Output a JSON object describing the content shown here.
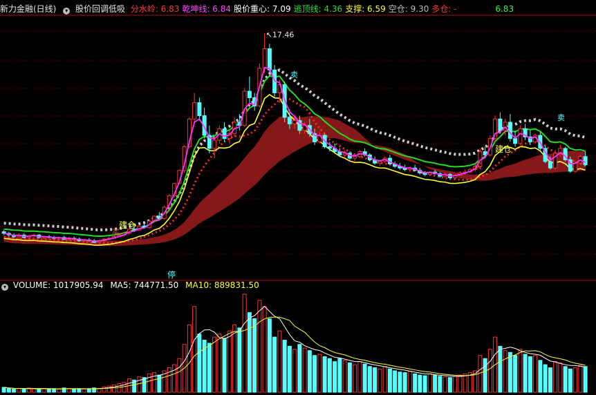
{
  "header": {
    "title": "新力金融(日线)",
    "indicator_name": "股价回调低吸",
    "fields": [
      {
        "label": "分水岭:",
        "value": "6.83",
        "color": "#ff3b3b"
      },
      {
        "label": "乾坤线:",
        "value": "6.84",
        "color": "#ff44ff"
      },
      {
        "label": "股价重心:",
        "value": "7.09",
        "color": "#ffffff"
      },
      {
        "label": "逃顶线:",
        "value": "4.36",
        "color": "#33dd33"
      },
      {
        "label": "支撑:",
        "value": "6.59",
        "color": "#ffff33"
      },
      {
        "label": "空仓:",
        "value": "9.30",
        "color": "#bbbbbb"
      },
      {
        "label": "多仓:",
        "value": "-",
        "color": "#ff3333"
      },
      {
        "label": "",
        "value": "6.83",
        "color": "#33ff33"
      }
    ]
  },
  "volume_header": {
    "volume_label": "VOLUME:",
    "volume_value": "1017905.94",
    "ma5_label": "MA5:",
    "ma5_value": "744771.50",
    "ma10_label": "MA10:",
    "ma10_value": "889831.50"
  },
  "annotations": {
    "high_price": "17.46",
    "limit_up": "停",
    "build_position": "建仓",
    "sell": "卖",
    "buy": "买"
  },
  "colors": {
    "background": "#000000",
    "up_candle": "#ff3333",
    "down_candle": "#54ffff",
    "grid": "#8b0000",
    "line_green": "#22dd22",
    "line_magenta": "#ff33ff",
    "line_yellow": "#ffff33",
    "band_red": "#b22222",
    "band_green": "#1f6b3a"
  },
  "chart_data": {
    "type": "candlestick",
    "title": "新力金融(日线)",
    "ohlc": [
      [
        5.3,
        5.4,
        5.1,
        5.2
      ],
      [
        5.2,
        5.3,
        5.0,
        5.1
      ],
      [
        5.1,
        5.2,
        4.9,
        5.0
      ],
      [
        5.0,
        5.2,
        4.9,
        5.1
      ],
      [
        5.1,
        5.2,
        4.9,
        4.95
      ],
      [
        4.95,
        5.1,
        4.85,
        5.05
      ],
      [
        5.05,
        5.2,
        4.95,
        5.1
      ],
      [
        5.1,
        5.15,
        4.9,
        4.95
      ],
      [
        4.95,
        5.05,
        4.85,
        5.0
      ],
      [
        5.0,
        5.1,
        4.9,
        4.95
      ],
      [
        4.95,
        5.05,
        4.85,
        4.9
      ],
      [
        4.9,
        5.0,
        4.8,
        4.95
      ],
      [
        4.95,
        5.05,
        4.8,
        4.85
      ],
      [
        4.85,
        5.0,
        4.75,
        4.9
      ],
      [
        4.9,
        5.0,
        4.8,
        4.85
      ],
      [
        4.85,
        4.95,
        4.7,
        4.75
      ],
      [
        4.75,
        4.85,
        4.65,
        4.8
      ],
      [
        4.8,
        4.9,
        4.7,
        4.75
      ],
      [
        4.75,
        4.85,
        4.6,
        4.65
      ],
      [
        4.65,
        4.8,
        4.6,
        4.75
      ],
      [
        4.75,
        4.9,
        4.7,
        4.85
      ],
      [
        4.85,
        5.0,
        4.8,
        4.9
      ],
      [
        4.9,
        5.1,
        4.85,
        5.0
      ],
      [
        5.0,
        5.2,
        4.95,
        5.1
      ],
      [
        5.1,
        5.3,
        5.0,
        5.2
      ],
      [
        5.2,
        5.5,
        5.1,
        5.45
      ],
      [
        5.45,
        5.6,
        5.3,
        5.4
      ],
      [
        5.4,
        5.7,
        5.35,
        5.65
      ],
      [
        5.65,
        5.8,
        5.5,
        5.55
      ],
      [
        5.55,
        6.0,
        5.5,
        5.95
      ],
      [
        5.95,
        6.3,
        5.9,
        6.25
      ],
      [
        6.25,
        6.5,
        6.0,
        6.1
      ],
      [
        6.1,
        6.9,
        6.05,
        6.8
      ],
      [
        6.8,
        7.6,
        6.7,
        7.5
      ],
      [
        7.5,
        8.3,
        7.4,
        8.25
      ],
      [
        8.25,
        9.1,
        8.2,
        9.05
      ],
      [
        9.05,
        10.6,
        8.9,
        10.5
      ],
      [
        10.5,
        12.3,
        10.4,
        12.2
      ],
      [
        12.2,
        13.8,
        11.9,
        13.2
      ],
      [
        13.2,
        13.5,
        12.1,
        12.4
      ],
      [
        12.4,
        12.9,
        11.0,
        11.2
      ],
      [
        11.2,
        11.8,
        10.1,
        10.4
      ],
      [
        10.4,
        11.1,
        9.8,
        10.9
      ],
      [
        10.9,
        11.8,
        10.7,
        11.6
      ],
      [
        11.6,
        12.0,
        10.8,
        11.0
      ],
      [
        11.0,
        11.5,
        10.7,
        11.3
      ],
      [
        11.3,
        12.3,
        11.1,
        12.0
      ],
      [
        12.0,
        12.5,
        11.5,
        11.8
      ],
      [
        11.8,
        14.1,
        11.7,
        13.9
      ],
      [
        13.9,
        14.8,
        13.2,
        13.5
      ],
      [
        13.5,
        13.8,
        12.7,
        13.0
      ],
      [
        13.0,
        15.6,
        12.9,
        15.3
      ],
      [
        15.3,
        17.46,
        15.0,
        16.5
      ],
      [
        16.5,
        16.8,
        14.8,
        15.2
      ],
      [
        15.2,
        15.5,
        13.5,
        13.8
      ],
      [
        13.8,
        14.6,
        13.2,
        14.3
      ],
      [
        14.3,
        14.5,
        12.0,
        12.3
      ],
      [
        12.3,
        12.8,
        11.6,
        11.9
      ],
      [
        11.9,
        12.4,
        11.6,
        12.1
      ],
      [
        12.1,
        12.4,
        11.3,
        11.5
      ],
      [
        11.5,
        12.0,
        11.3,
        11.8
      ],
      [
        11.8,
        12.2,
        11.1,
        11.3
      ],
      [
        11.3,
        11.6,
        10.6,
        10.8
      ],
      [
        10.8,
        11.4,
        10.7,
        11.2
      ],
      [
        11.2,
        11.3,
        10.4,
        10.5
      ],
      [
        10.5,
        10.8,
        10.2,
        10.4
      ],
      [
        10.4,
        10.7,
        10.1,
        10.2
      ],
      [
        10.2,
        10.4,
        9.9,
        10.0
      ],
      [
        10.0,
        10.3,
        9.8,
        10.1
      ],
      [
        10.1,
        10.2,
        9.7,
        9.8
      ],
      [
        9.8,
        10.1,
        9.6,
        9.9
      ],
      [
        9.9,
        10.3,
        9.8,
        10.2
      ],
      [
        10.2,
        10.4,
        9.9,
        10.0
      ],
      [
        10.0,
        10.1,
        9.6,
        9.7
      ],
      [
        9.7,
        9.9,
        9.4,
        9.5
      ],
      [
        9.5,
        9.7,
        9.3,
        9.6
      ],
      [
        9.6,
        9.9,
        9.5,
        9.8
      ],
      [
        9.8,
        10.0,
        9.4,
        9.45
      ],
      [
        9.45,
        9.6,
        9.2,
        9.3
      ],
      [
        9.3,
        9.5,
        9.1,
        9.2
      ],
      [
        9.2,
        9.4,
        9.0,
        9.1
      ],
      [
        9.1,
        9.3,
        8.95,
        9.2
      ],
      [
        9.2,
        9.4,
        9.0,
        9.05
      ],
      [
        9.05,
        9.2,
        8.8,
        8.9
      ],
      [
        8.9,
        9.0,
        8.7,
        8.8
      ],
      [
        8.8,
        9.0,
        8.7,
        8.95
      ],
      [
        8.95,
        9.1,
        8.8,
        8.85
      ],
      [
        8.85,
        8.95,
        8.6,
        8.7
      ],
      [
        8.7,
        8.9,
        8.6,
        8.8
      ],
      [
        8.8,
        8.9,
        8.5,
        8.6
      ],
      [
        8.6,
        8.8,
        8.5,
        8.75
      ],
      [
        8.75,
        9.0,
        8.7,
        8.9
      ],
      [
        8.9,
        9.1,
        8.8,
        8.95
      ],
      [
        8.95,
        9.2,
        8.9,
        9.1
      ],
      [
        9.1,
        9.4,
        9.0,
        9.3
      ],
      [
        9.3,
        10.4,
        9.2,
        10.2
      ],
      [
        10.2,
        10.5,
        9.8,
        10.0
      ],
      [
        10.0,
        11.2,
        9.9,
        11.0
      ],
      [
        11.0,
        12.4,
        10.9,
        12.2
      ],
      [
        12.2,
        12.6,
        11.3,
        11.5
      ],
      [
        11.5,
        12.2,
        11.2,
        12.0
      ],
      [
        12.0,
        12.5,
        10.8,
        11.0
      ],
      [
        11.0,
        11.5,
        10.5,
        10.7
      ],
      [
        10.7,
        11.8,
        10.6,
        11.6
      ],
      [
        11.6,
        11.9,
        10.9,
        11.1
      ],
      [
        11.1,
        11.5,
        10.6,
        10.8
      ],
      [
        10.8,
        11.3,
        10.7,
        11.2
      ],
      [
        11.2,
        11.4,
        10.3,
        10.4
      ],
      [
        10.4,
        10.6,
        9.5,
        9.6
      ],
      [
        9.6,
        9.9,
        9.1,
        9.2
      ],
      [
        9.2,
        10.3,
        9.1,
        10.1
      ],
      [
        10.1,
        10.6,
        9.9,
        10.4
      ],
      [
        10.4,
        10.5,
        9.6,
        9.7
      ],
      [
        9.7,
        9.9,
        8.9,
        9.0
      ],
      [
        9.0,
        9.6,
        8.9,
        9.5
      ],
      [
        9.5,
        10.0,
        9.4,
        9.9
      ],
      [
        9.9,
        10.2,
        9.3,
        9.4
      ]
    ],
    "volume": [
      8,
      6,
      5,
      6,
      5,
      7,
      6,
      5,
      6,
      5,
      6,
      5,
      7,
      6,
      5,
      6,
      5,
      6,
      7,
      6,
      9,
      10,
      12,
      14,
      16,
      22,
      20,
      25,
      24,
      30,
      32,
      28,
      35,
      40,
      45,
      55,
      78,
      110,
      140,
      95,
      85,
      80,
      90,
      95,
      88,
      100,
      110,
      105,
      160,
      130,
      120,
      150,
      140,
      120,
      90,
      100,
      85,
      75,
      70,
      78,
      72,
      68,
      60,
      62,
      58,
      55,
      50,
      55,
      52,
      48,
      45,
      50,
      46,
      42,
      40,
      38,
      42,
      38,
      35,
      33,
      32,
      34,
      30,
      28,
      27,
      30,
      28,
      26,
      25,
      24,
      26,
      28,
      30,
      32,
      35,
      60,
      55,
      70,
      90,
      75,
      68,
      65,
      60,
      70,
      62,
      58,
      60,
      52,
      45,
      40,
      50,
      48,
      42,
      38,
      40,
      44,
      42
    ],
    "ma5_volume": 744771.5,
    "ma10_volume": 889831.5,
    "high_label": 17.46
  }
}
